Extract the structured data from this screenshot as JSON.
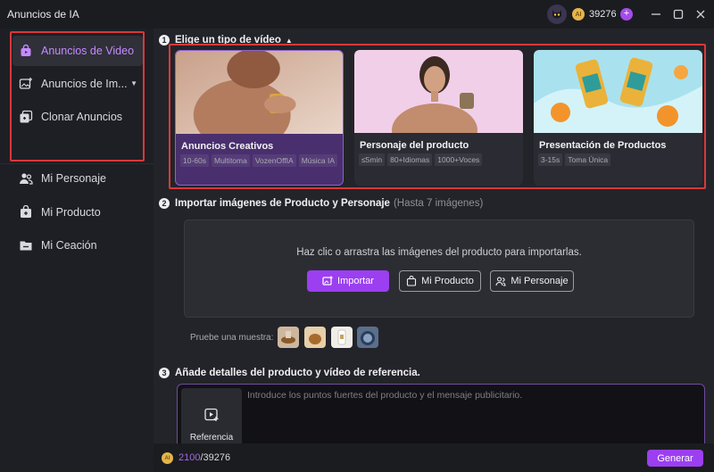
{
  "app": {
    "title": "Anuncios de IA",
    "credits": "39276",
    "plus": "+",
    "coin_label": "AI"
  },
  "sidebar": {
    "items": [
      {
        "label": "Anuncios de Video",
        "icon": "shopping-bag-icon",
        "active": true
      },
      {
        "label": "Anuncios de Im...",
        "icon": "image-plus-icon",
        "caret": "▼"
      },
      {
        "label": "Clonar Anuncios",
        "icon": "clone-icon"
      },
      {
        "label": "Mi Personaje",
        "icon": "people-icon"
      },
      {
        "label": "Mi Producto",
        "icon": "product-box-icon"
      },
      {
        "label": "Mi Ceación",
        "icon": "folder-icon"
      }
    ]
  },
  "step1": {
    "num": "1",
    "title": "Elige un tipo de vídeo",
    "caret": "▲",
    "cards": [
      {
        "title": "Anuncios Creativos",
        "tags": [
          "10-60s",
          "Multitoma",
          "VozenOffIA",
          "Música IA"
        ]
      },
      {
        "title": "Personaje del producto",
        "tags": [
          "≤5min",
          "80+Idiomas",
          "1000+Voces"
        ]
      },
      {
        "title": "Presentación de Productos",
        "tags": [
          "3-15s",
          "Toma Única"
        ]
      }
    ]
  },
  "step2": {
    "num": "2",
    "title": "Importar imágenes de Producto y Personaje",
    "hint": "(Hasta 7 imágenes)",
    "upload_msg": "Haz clic o arrastra las imágenes del producto para importarlas.",
    "import_label": "Importar",
    "product_label": "Mi Producto",
    "persona_label": "Mi Personaje",
    "sample_label": "Pruebe una muestra:"
  },
  "step3": {
    "num": "3",
    "title": "Añade detalles del producto y vídeo de referencia.",
    "reference_label": "Referencia",
    "placeholder": "Introduce los puntos fuertes del producto y el mensaje publicitario."
  },
  "bottom": {
    "cost": "2100",
    "total": "/39276",
    "generate_label": "Generar"
  },
  "colors": {
    "accent": "#9b3ff0",
    "active_text": "#c58aff",
    "highlight_border": "#d8383a"
  }
}
